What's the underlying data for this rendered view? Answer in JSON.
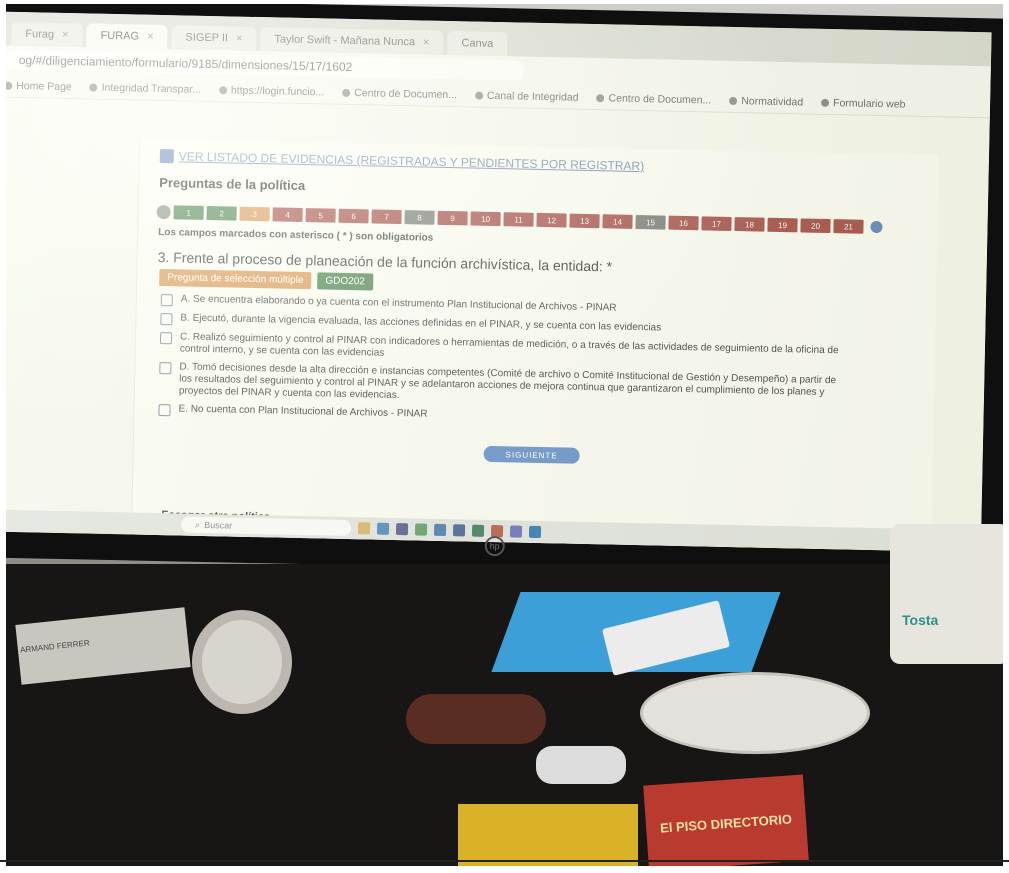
{
  "browser": {
    "tabs": [
      {
        "label": "Furag",
        "active": false
      },
      {
        "label": "FURAG",
        "active": true
      },
      {
        "label": "SIGEP II",
        "active": false
      },
      {
        "label": "Taylor Swift - Mañana Nunca",
        "active": false
      },
      {
        "label": "Canva",
        "active": false
      }
    ],
    "close_glyph": "×",
    "url": "og/#/diligenciamiento/formulario/9185/dimensiones/15/17/1602",
    "bookmarks": [
      "Home Page",
      "Integridad Transpar...",
      "https://login.funcio...",
      "Centro de Documen...",
      "Canal de Integridad",
      "Centro de Documen...",
      "Normatividad",
      "Formulario web"
    ]
  },
  "form": {
    "evidence_link": "VER LISTADO DE EVIDENCIAS (REGISTRADAS Y PENDIENTES POR REGISTRAR)",
    "section_title": "Preguntas de la política",
    "question_numbers": [
      "1",
      "2",
      "3",
      "4",
      "5",
      "6",
      "7",
      "8",
      "9",
      "10",
      "11",
      "12",
      "13",
      "14",
      "15",
      "16",
      "17",
      "18",
      "19",
      "20",
      "21"
    ],
    "question_status_colors": [
      "#2e7d32",
      "#2e7d32",
      "#e08a2e",
      "#b23a2e",
      "#b23a2e",
      "#b23a2e",
      "#b23a2e",
      "#6b6f66",
      "#b23a2e",
      "#b23a2e",
      "#b23a2e",
      "#b23a2e",
      "#b23a2e",
      "#b23a2e",
      "#6b6f66",
      "#b23a2e",
      "#b23a2e",
      "#b23a2e",
      "#b23a2e",
      "#b23a2e",
      "#b23a2e"
    ],
    "required_note": "Los campos marcados con asterisco ( * ) son obligatorios",
    "question": "3. Frente al proceso de planeación de la función archivística, la entidad: *",
    "tags": [
      {
        "label": "Pregunta de selección múltiple",
        "color": "#e58a2a"
      },
      {
        "label": "GDO202",
        "color": "#2e7d32"
      }
    ],
    "options": [
      "A. Se encuentra elaborando o ya cuenta con el instrumento Plan Institucional de Archivos - PINAR",
      "B. Ejecutó, durante la vigencia evaluada, las acciones definidas en el PINAR, y se cuenta con las evidencias",
      "C. Realizó seguimiento y control al PINAR con indicadores o herramientas de medición, o a través de las actividades de seguimiento de la oficina de control interno, y se cuenta con las evidencias",
      "D. Tomó decisiones desde la alta dirección e instancias competentes (Comité de archivo o Comité Institucional de Gestión y Desempeño) a partir de los resultados del seguimiento y control al PINAR y se adelantaron acciones de mejora continua que garantizaron el cumplimiento de los planes y proyectos del PINAR y cuenta con las evidencias.",
      "E. No cuenta con Plan Institucional de Archivos - PINAR"
    ],
    "submit_label": "SIGUIENTE",
    "other_policy": "Escoger otra política"
  },
  "taskbar": {
    "search_placeholder": "Buscar"
  },
  "desk": {
    "cup_label": "Tosta",
    "sticker_text": "El PISO DIRECTORIO",
    "paper_text": "ARMAND FERRER"
  },
  "colors": {
    "link": "#5a7fb0",
    "submit": "#4f86d6",
    "screen_bg": "#e9ecd9"
  }
}
